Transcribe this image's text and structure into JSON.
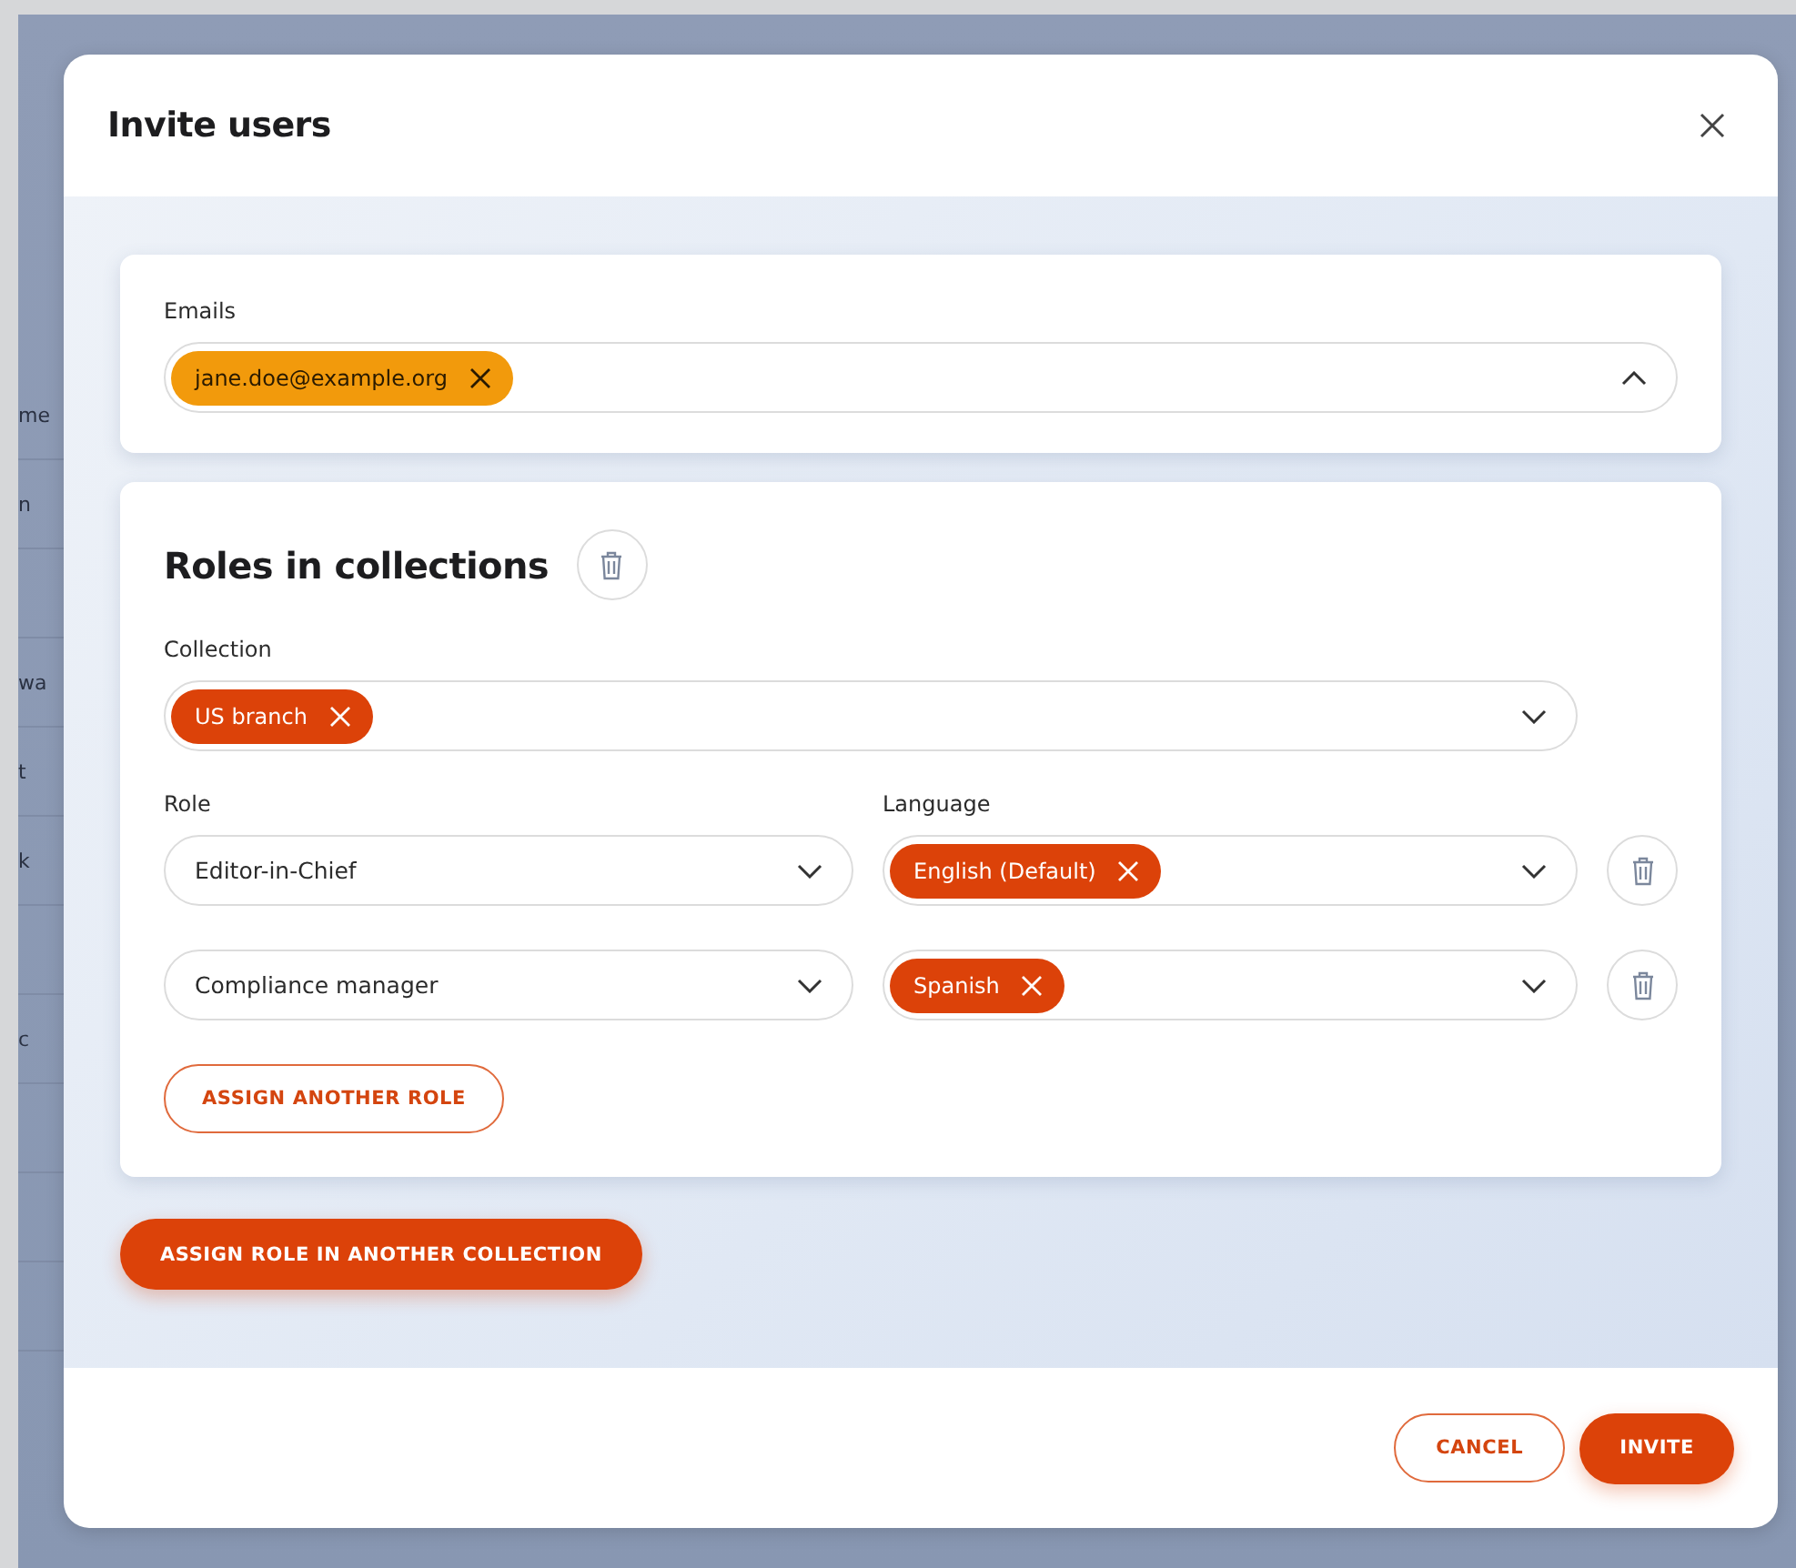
{
  "background_table": {
    "rows": [
      {
        "text": "me"
      },
      {
        "text": "n"
      },
      {},
      {
        "text": "wa"
      },
      {
        "text": "t"
      },
      {
        "text": "k"
      },
      {},
      {
        "text": "c"
      },
      {},
      {},
      {}
    ]
  },
  "dialog": {
    "title": "Invite users",
    "emails": {
      "label": "Emails",
      "chips": [
        "jane.doe@example.org"
      ],
      "expanded": true
    },
    "roles_section": {
      "title": "Roles in collections",
      "collection": {
        "label": "Collection",
        "chips": [
          "US branch"
        ],
        "expanded": false
      },
      "role_label": "Role",
      "language_label": "Language",
      "assignments": [
        {
          "role": "Editor-in-Chief",
          "role_expanded": false,
          "languages": [
            "English (Default)"
          ],
          "languages_expanded": false
        },
        {
          "role": "Compliance manager",
          "role_expanded": false,
          "languages": [
            "Spanish"
          ],
          "languages_expanded": false
        }
      ],
      "assign_button": "ASSIGN ANOTHER ROLE"
    },
    "another_collection_button": "ASSIGN ROLE IN ANOTHER COLLECTION",
    "footer_buttons": [
      {
        "label": "CANCEL",
        "kind": "secondary"
      },
      {
        "label": "INVITE",
        "kind": "primary"
      }
    ]
  }
}
